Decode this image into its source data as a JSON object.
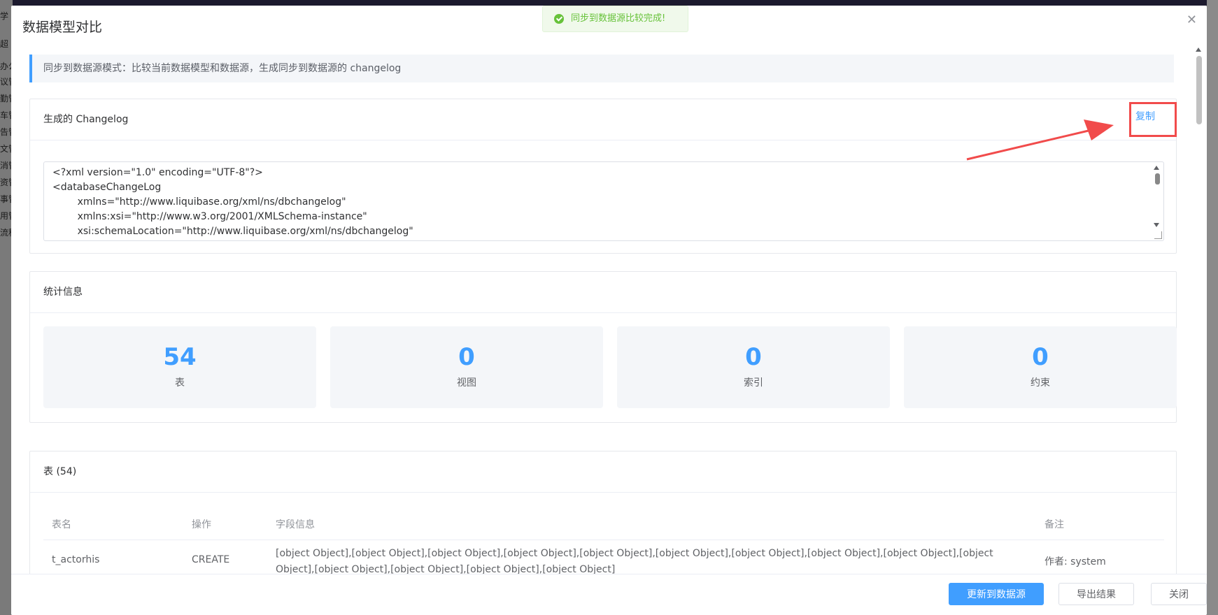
{
  "dialog": {
    "title": "数据模型对比",
    "info": "同步到数据源模式：比较当前数据模型和数据源，生成同步到数据源的 changelog"
  },
  "toast": {
    "text": "同步到数据源比较完成!"
  },
  "background": {
    "side_items": [
      "学",
      "超",
      "办公",
      "议管",
      "勤管",
      "车管",
      "告管",
      "文管",
      "消管",
      "资管",
      "事管",
      "用管",
      "流程"
    ]
  },
  "changelog": {
    "title": "生成的 Changelog",
    "copy_label": "复制",
    "lines": [
      "<?xml version=\"1.0\" encoding=\"UTF-8\"?>",
      "<databaseChangeLog",
      "        xmlns=\"http://www.liquibase.org/xml/ns/dbchangelog\"",
      "        xmlns:xsi=\"http://www.w3.org/2001/XMLSchema-instance\"",
      "        xsi:schemaLocation=\"http://www.liquibase.org/xml/ns/dbchangelog\""
    ]
  },
  "stats": {
    "title": "统计信息",
    "items": [
      {
        "value": "54",
        "label": "表"
      },
      {
        "value": "0",
        "label": "视图"
      },
      {
        "value": "0",
        "label": "索引"
      },
      {
        "value": "0",
        "label": "约束"
      }
    ]
  },
  "tables": {
    "title": "表 (54)",
    "columns": [
      "表名",
      "操作",
      "字段信息",
      "备注"
    ],
    "rows": [
      {
        "name": "t_actorhis",
        "op": "CREATE",
        "fields": "[object Object],[object Object],[object Object],[object Object],[object Object],[object Object],[object Object],[object Object],[object Object],[object Object],[object Object],[object Object],[object Object],[object Object]",
        "note": "作者: system"
      }
    ]
  },
  "footer": {
    "update_label": "更新到数据源",
    "export_label": "导出结果",
    "close_label": "关闭"
  },
  "colors": {
    "primary": "#409eff",
    "success": "#67c23a",
    "annotation": "#f14b4b"
  }
}
